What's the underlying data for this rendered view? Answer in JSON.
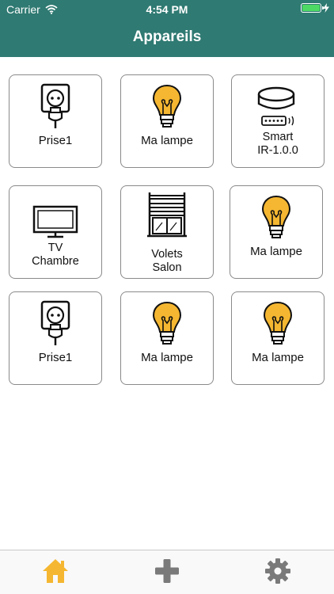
{
  "status_bar": {
    "carrier": "Carrier",
    "time": "4:54 PM",
    "battery_level": 1.0
  },
  "header": {
    "title": "Appareils"
  },
  "devices": [
    {
      "label": "Prise1",
      "icon": "plug-icon"
    },
    {
      "label": "Ma lampe",
      "icon": "lightbulb-icon"
    },
    {
      "label_line1": "Smart",
      "label_line2": "IR-1.0.0",
      "icon": "ir-remote-icon"
    },
    {
      "label_line1": "TV",
      "label_line2": "Chambre",
      "icon": "tv-icon"
    },
    {
      "label_line1": "Volets",
      "label_line2": "Salon",
      "icon": "shutter-icon"
    },
    {
      "label": "Ma lampe",
      "icon": "lightbulb-icon"
    },
    {
      "label": "Prise1",
      "icon": "plug-icon"
    },
    {
      "label": "Ma lampe",
      "icon": "lightbulb-icon"
    },
    {
      "label": "Ma lampe",
      "icon": "lightbulb-icon"
    }
  ],
  "tab_bar": {
    "items": [
      {
        "icon": "home-icon",
        "active": true
      },
      {
        "icon": "plus-icon",
        "active": false
      },
      {
        "icon": "gear-icon",
        "active": false
      }
    ]
  },
  "colors": {
    "header": "#2f7a72",
    "bulb": "#f5b731",
    "tab_active": "#f5b731",
    "tab_inactive": "#7a7a7a"
  }
}
